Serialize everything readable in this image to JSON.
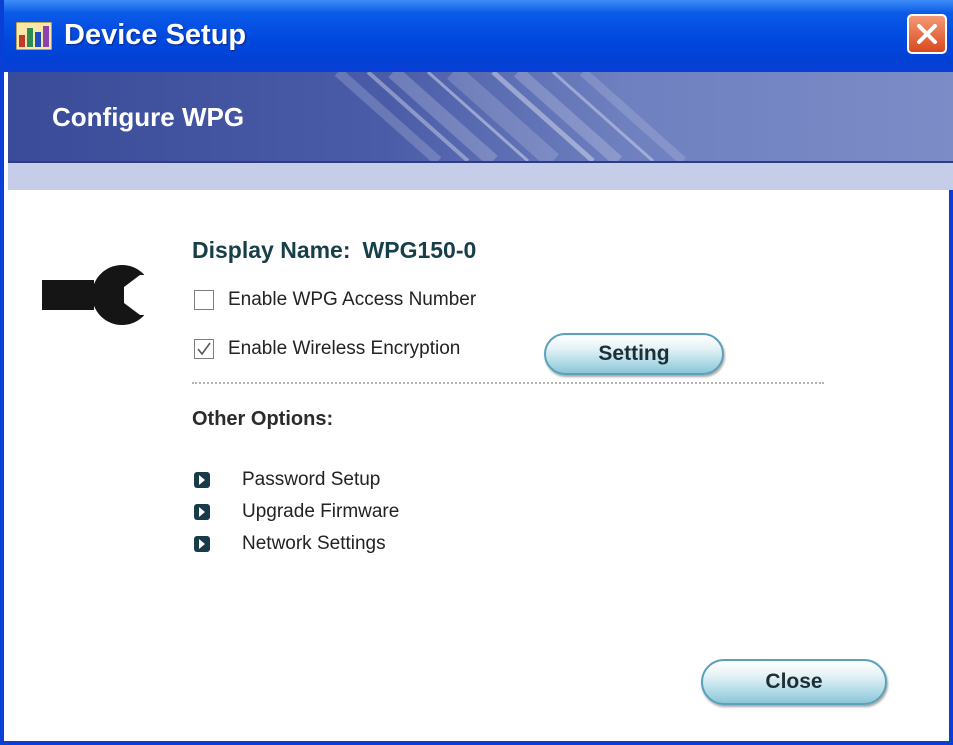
{
  "window": {
    "title": "Device Setup"
  },
  "banner": {
    "title": "Configure WPG"
  },
  "device": {
    "display_name_label": "Display Name:",
    "display_name_value": "WPG150-0"
  },
  "options": {
    "access_number": {
      "label": "Enable WPG Access Number",
      "checked": false
    },
    "wireless_encryption": {
      "label": "Enable Wireless Encryption",
      "checked": true
    }
  },
  "setting_button": {
    "label": "Setting"
  },
  "other_options": {
    "heading": "Other Options:",
    "items": [
      {
        "label": "Password Setup"
      },
      {
        "label": "Upgrade Firmware"
      },
      {
        "label": "Network Settings"
      }
    ]
  },
  "close_button": {
    "label": "Close"
  },
  "colors": {
    "title_bar": "#0048de",
    "banner": "#4a5ca7",
    "accent_text": "#173f49",
    "button": "#b4dce8",
    "close_x": "#d9481e"
  },
  "icons": {
    "app": "app-icon",
    "tool": "wrench-icon",
    "bullet": "arrow-right-icon",
    "close": "close-icon"
  }
}
